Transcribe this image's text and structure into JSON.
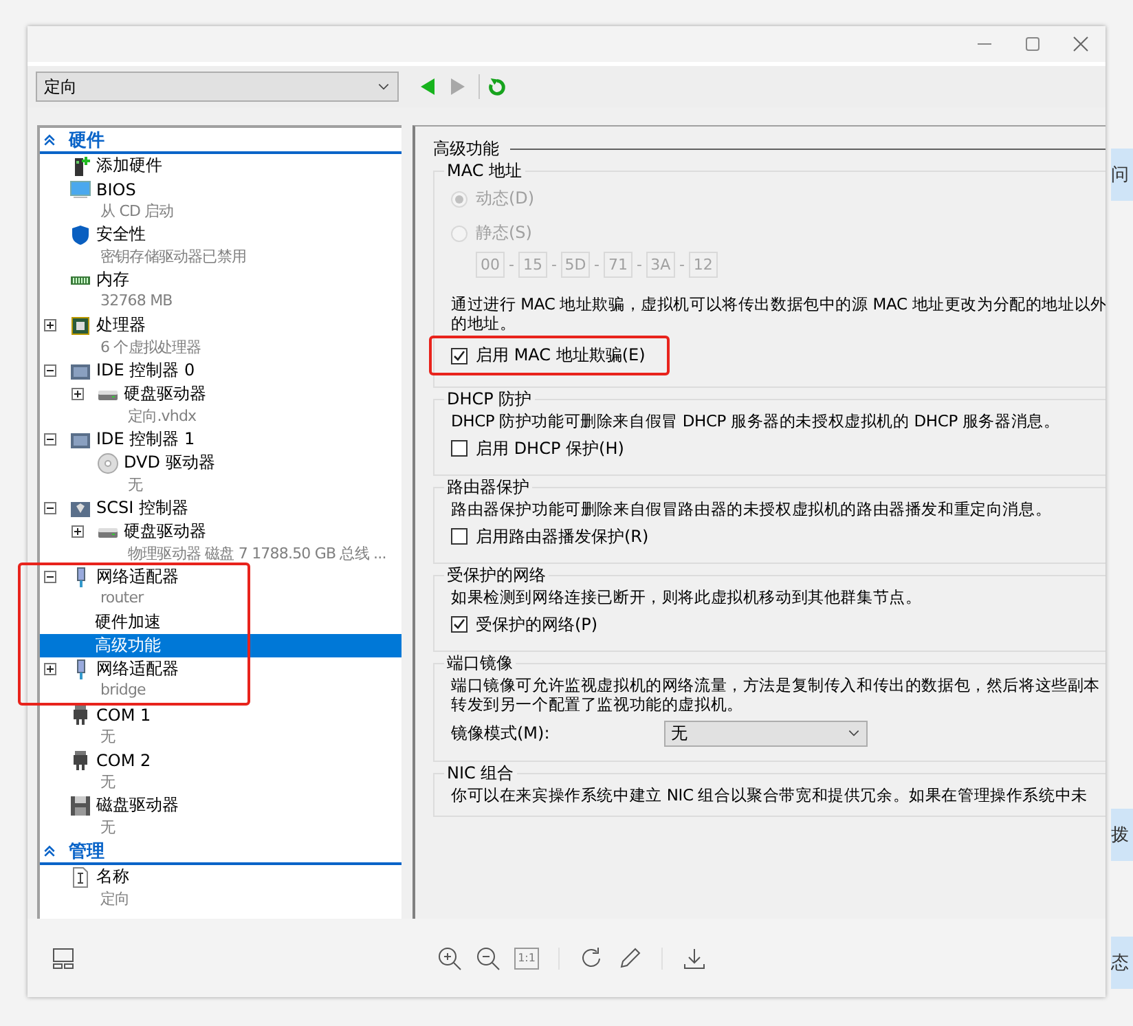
{
  "toolbar": {
    "vm_select": {
      "value": "定向"
    },
    "back": {
      "disabled": false
    },
    "forward": {
      "disabled": true
    }
  },
  "tree": {
    "sections": [
      {
        "title": "硬件",
        "expanded": true,
        "items": [
          {
            "kind": "add",
            "label": "添加硬件",
            "selected": false
          },
          {
            "kind": "bios",
            "label": "BIOS",
            "sub": "从 CD 启动",
            "selected": false
          },
          {
            "kind": "security",
            "label": "安全性",
            "sub": "密钥存储驱动器已禁用",
            "selected": false
          },
          {
            "kind": "memory",
            "label": "内存",
            "sub": "32768 MB",
            "selected": false
          },
          {
            "kind": "cpu",
            "label": "处理器",
            "sub": "6 个虚拟处理器",
            "expanded": false,
            "selected": false
          },
          {
            "kind": "controller",
            "label": "IDE 控制器 0",
            "expanded": true,
            "selected": false,
            "children": [
              {
                "kind": "disk",
                "label": "硬盘驱动器",
                "sub": "定向.vhdx",
                "expanded": false,
                "selected": false
              }
            ]
          },
          {
            "kind": "controller",
            "label": "IDE 控制器 1",
            "expanded": true,
            "selected": false,
            "children": [
              {
                "kind": "dvd",
                "label": "DVD 驱动器",
                "sub": "无",
                "selected": false
              }
            ]
          },
          {
            "kind": "scsi",
            "label": "SCSI 控制器",
            "expanded": true,
            "selected": false,
            "children": [
              {
                "kind": "disk",
                "label": "硬盘驱动器",
                "sub": "物理驱动器 磁盘 7 1788.50 GB 总线 ...",
                "expanded": false,
                "selected": false
              }
            ]
          },
          {
            "kind": "network",
            "label": "网络适配器",
            "sub": "router",
            "expanded": true,
            "highlighted": true,
            "selected": false,
            "children": [
              {
                "kind": "setting",
                "label": "硬件加速",
                "selected": false,
                "highlighted": true
              },
              {
                "kind": "setting",
                "label": "高级功能",
                "selected": true,
                "highlighted": true
              }
            ]
          },
          {
            "kind": "network",
            "label": "网络适配器",
            "sub": "bridge",
            "expanded": false,
            "highlighted": true,
            "selected": false
          },
          {
            "kind": "port",
            "label": "COM 1",
            "sub": "无",
            "selected": false
          },
          {
            "kind": "port",
            "label": "COM 2",
            "sub": "无",
            "selected": false
          },
          {
            "kind": "floppy",
            "label": "磁盘驱动器",
            "sub": "无",
            "selected": false
          }
        ]
      },
      {
        "title": "管理",
        "expanded": true,
        "items": [
          {
            "kind": "name",
            "label": "名称",
            "sub": "定向",
            "selected": false
          }
        ]
      }
    ]
  },
  "panel": {
    "title": "高级功能",
    "groups": [
      {
        "legend": "MAC 地址",
        "items": [
          {
            "kind": "radio",
            "label": "动态(D)",
            "selected": true,
            "disabled": true
          },
          {
            "kind": "radio",
            "label": "静态(S)",
            "selected": false,
            "disabled": true
          },
          {
            "kind": "mac",
            "octets": [
              "00",
              "15",
              "5D",
              "71",
              "3A",
              "12"
            ],
            "separators": [
              "-",
              "-",
              "-",
              "-",
              "-"
            ],
            "disabled": true
          },
          {
            "kind": "text",
            "text": "通过进行 MAC 地址欺骗，虚拟机可以将传出数据包中的源 MAC 地址更改为分配的地址以外的地址。"
          },
          {
            "kind": "checkbox",
            "label": "启用 MAC 地址欺骗(E)",
            "checked": true,
            "highlighted": true
          }
        ]
      },
      {
        "legend": "DHCP 防护",
        "items": [
          {
            "kind": "text",
            "text": "DHCP 防护功能可删除来自假冒 DHCP 服务器的未授权虚拟机的 DHCP 服务器消息。"
          },
          {
            "kind": "checkbox",
            "label": "启用 DHCP 保护(H)",
            "checked": false,
            "highlighted": false
          }
        ]
      },
      {
        "legend": "路由器保护",
        "items": [
          {
            "kind": "text",
            "text": "路由器保护功能可删除来自假冒路由器的未授权虚拟机的路由器播发和重定向消息。"
          },
          {
            "kind": "checkbox",
            "label": "启用路由器播发保护(R)",
            "checked": false,
            "highlighted": false
          }
        ]
      },
      {
        "legend": "受保护的网络",
        "items": [
          {
            "kind": "text",
            "text": "如果检测到网络连接已断开，则将此虚拟机移动到其他群集节点。"
          },
          {
            "kind": "checkbox",
            "label": "受保护的网络(P)",
            "checked": true,
            "highlighted": false
          }
        ]
      },
      {
        "legend": "端口镜像",
        "items": [
          {
            "kind": "text",
            "text": "端口镜像可允许监视虚拟机的网络流量，方法是复制传入和传出的数据包，然后将这些副本转发到另一个配置了监视功能的虚拟机。"
          },
          {
            "kind": "select",
            "label": "镜像模式(M):",
            "value": "无"
          }
        ]
      },
      {
        "legend": "NIC 组合",
        "items": [
          {
            "kind": "text",
            "text": "你可以在来宾操作系统中建立 NIC 组合以聚合带宽和提供冗余。如果在管理操作系统中未"
          }
        ]
      }
    ]
  },
  "viewer_toolbar": {
    "buttons": [
      {
        "kind": "zoom-in",
        "disabled": false
      },
      {
        "kind": "zoom-out",
        "disabled": false
      },
      {
        "kind": "actual-size",
        "label": "1:1",
        "disabled": true
      },
      {
        "kind": "separator"
      },
      {
        "kind": "rotate",
        "disabled": false
      },
      {
        "kind": "edit",
        "disabled": false
      },
      {
        "kind": "separator"
      },
      {
        "kind": "download",
        "disabled": false
      }
    ]
  },
  "background_tabs": [
    {
      "label": "问"
    },
    {
      "label": "拨"
    },
    {
      "label": "态"
    }
  ]
}
